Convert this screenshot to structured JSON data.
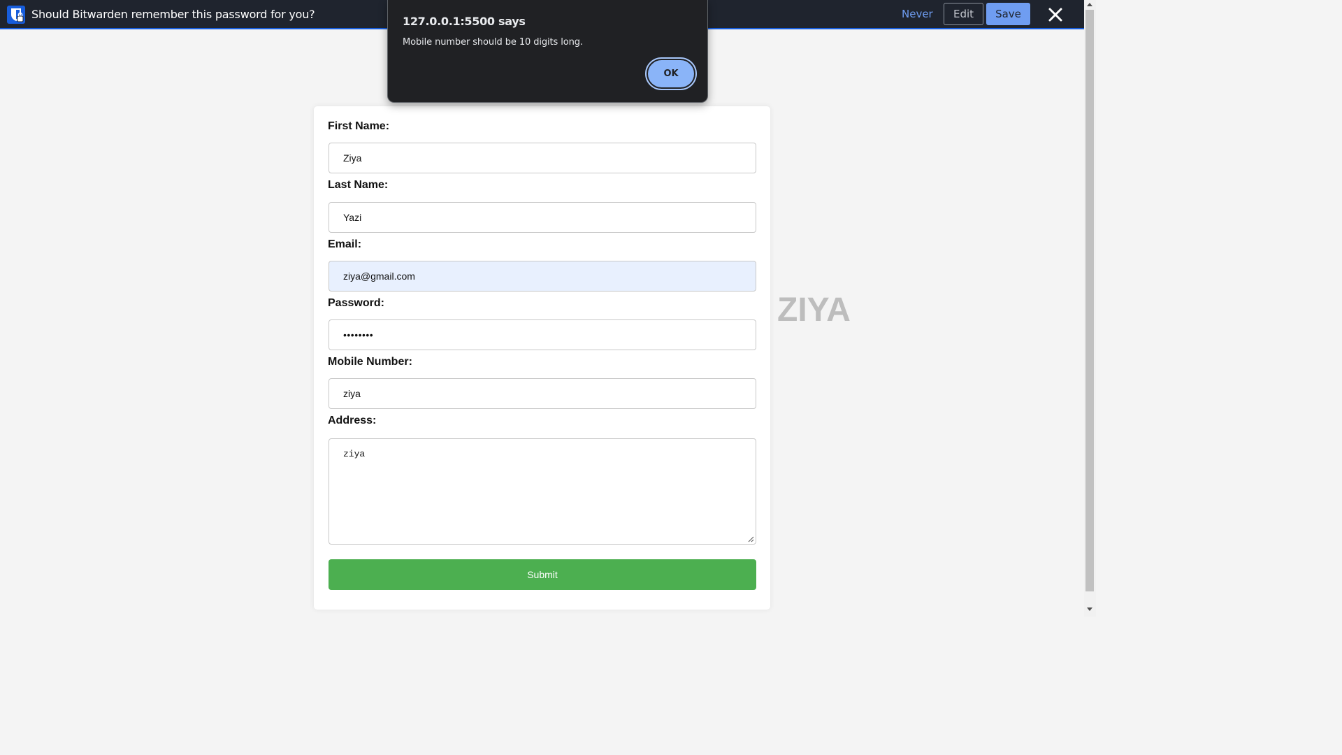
{
  "bitwarden_bar": {
    "message": "Should Bitwarden remember this password for you?",
    "never_label": "Never",
    "edit_label": "Edit",
    "save_label": "Save",
    "accent_color": "#175ddc",
    "link_color": "#6f9df1"
  },
  "alert": {
    "title": "127.0.0.1:5500 says",
    "message": "Mobile number should be 10 digits long.",
    "ok_label": "OK"
  },
  "form": {
    "first_name": {
      "label": "First Name:",
      "value": "Ziya"
    },
    "last_name": {
      "label": "Last Name:",
      "value": "Yazi"
    },
    "email": {
      "label": "Email:",
      "value": "ziya@gmail.com"
    },
    "password": {
      "label": "Password:",
      "value": "••••••••"
    },
    "mobile": {
      "label": "Mobile Number:",
      "value": "ziya"
    },
    "address": {
      "label": "Address:",
      "value": "ziya"
    },
    "submit_label": "Submit",
    "submit_color": "#4caf50"
  },
  "side_text": "ZIYA"
}
